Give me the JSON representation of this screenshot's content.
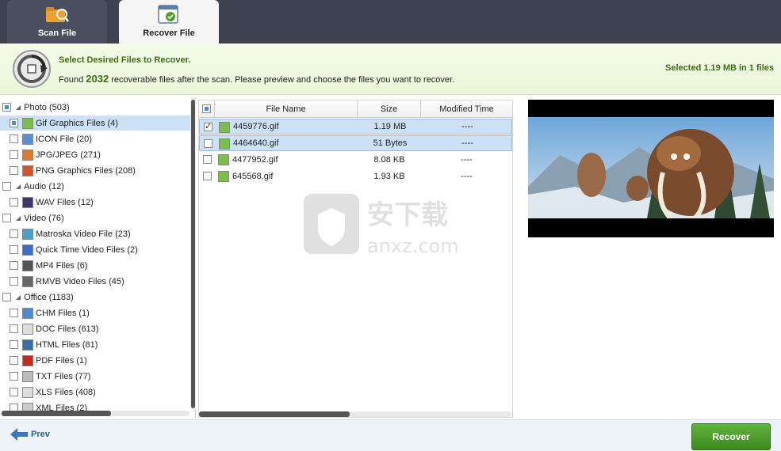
{
  "tabs": [
    {
      "label": "Scan File"
    },
    {
      "label": "Recover File"
    }
  ],
  "header": {
    "title": "Select Desired Files to Recover.",
    "found_prefix": "Found",
    "found_count": "2032",
    "found_suffix": "recoverable files after the scan. Please preview and choose the files you want to recover.",
    "selected_info": "Selected 1.19 MB in 1 files"
  },
  "tree": {
    "items": [
      {
        "label": "Photo (503)",
        "level": 0,
        "icon": "none"
      },
      {
        "label": "Gif Graphics Files (4)",
        "level": 1,
        "icon": "gif-icon"
      },
      {
        "label": "ICON File (20)",
        "level": 1,
        "icon": "ico-icon"
      },
      {
        "label": "JPG/JPEG (271)",
        "level": 1,
        "icon": "jpg-icon"
      },
      {
        "label": "PNG Graphics Files (208)",
        "level": 1,
        "icon": "png-icon"
      },
      {
        "label": "Audio (12)",
        "level": 0,
        "icon": "none"
      },
      {
        "label": "WAV Files (12)",
        "level": 1,
        "icon": "wav-icon"
      },
      {
        "label": "Video (76)",
        "level": 0,
        "icon": "none"
      },
      {
        "label": "Matroska Video File (23)",
        "level": 1,
        "icon": "mkv-icon"
      },
      {
        "label": "Quick Time Video Files (2)",
        "level": 1,
        "icon": "quicktime-icon"
      },
      {
        "label": "MP4 Files (6)",
        "level": 1,
        "icon": "mp4-icon"
      },
      {
        "label": "RMVB Video Files (45)",
        "level": 1,
        "icon": "rmvb-icon"
      },
      {
        "label": "Office (1183)",
        "level": 0,
        "icon": "none"
      },
      {
        "label": "CHM Files (1)",
        "level": 1,
        "icon": "chm-icon"
      },
      {
        "label": "DOC Files (613)",
        "level": 1,
        "icon": "doc-icon"
      },
      {
        "label": "HTML Files (81)",
        "level": 1,
        "icon": "html-icon"
      },
      {
        "label": "PDF Files (1)",
        "level": 1,
        "icon": "pdf-icon"
      },
      {
        "label": "TXT Files (77)",
        "level": 1,
        "icon": "txt-icon"
      },
      {
        "label": "XLS Files (408)",
        "level": 1,
        "icon": "xls-icon"
      },
      {
        "label": "XML Files (2)",
        "level": 1,
        "icon": "xml-icon"
      }
    ]
  },
  "filelist": {
    "columns": [
      "File Name",
      "Size",
      "Modified Time"
    ],
    "rows": [
      {
        "name": "4459776.gif",
        "size": "1.19 MB",
        "time": "----"
      },
      {
        "name": "4464640.gif",
        "size": "51 Bytes",
        "time": "----"
      },
      {
        "name": "4477952.gif",
        "size": "8.08 KB",
        "time": "----"
      },
      {
        "name": "645568.gif",
        "size": "1.93 KB",
        "time": "----"
      }
    ]
  },
  "watermark": {
    "cn": "安下载",
    "en": "anxz.com"
  },
  "bottom": {
    "prev_label": "Prev",
    "recover_label": "Recover"
  },
  "colors": {
    "accent_green": "#3d6e12",
    "button_green": "#4ea02b",
    "topbar": "#3d4350",
    "selection": "#cde1f6"
  }
}
